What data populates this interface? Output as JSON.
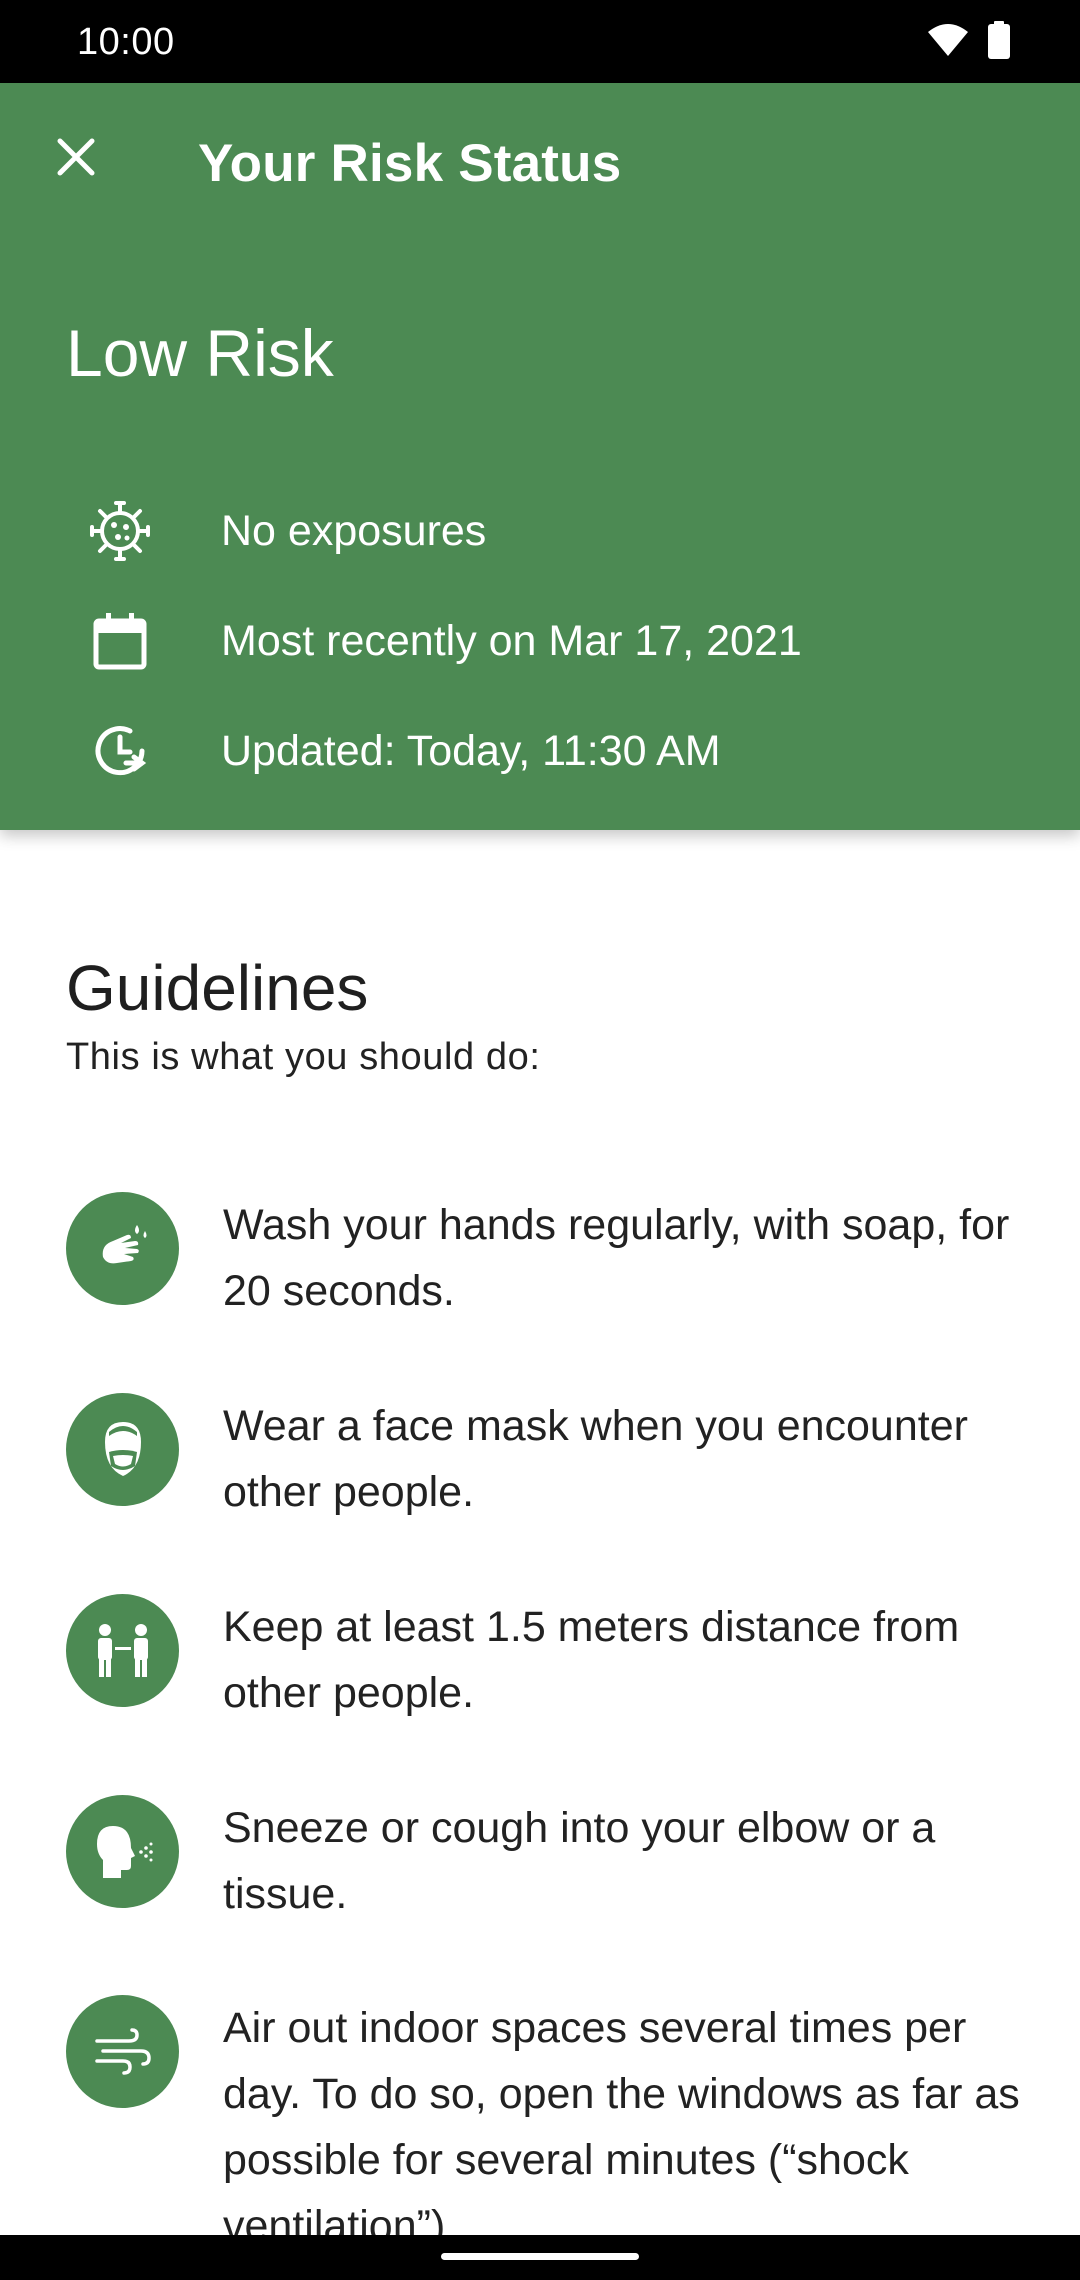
{
  "status_bar": {
    "time": "10:00",
    "icons": [
      "wifi-icon",
      "battery-icon"
    ]
  },
  "header": {
    "close_icon": "close-icon",
    "title": "Your Risk Status",
    "risk_level": "Low Risk",
    "rows": [
      {
        "icon": "virus-icon",
        "text": "No exposures"
      },
      {
        "icon": "calendar-icon",
        "text": "Most recently on Mar 17, 2021"
      },
      {
        "icon": "clock-refresh-icon",
        "text": "Updated: Today, 11:30 AM"
      }
    ]
  },
  "guidelines": {
    "title": "Guidelines",
    "subtitle": "This is what you should do:",
    "items": [
      {
        "icon": "hand-wash-icon",
        "text": "Wash your hands regularly, with soap, for 20 seconds."
      },
      {
        "icon": "face-mask-icon",
        "text": "Wear a face mask when you encounter other people."
      },
      {
        "icon": "distance-icon",
        "text": "Keep at least 1.5 meters distance from other people."
      },
      {
        "icon": "sneeze-icon",
        "text": "Sneeze or cough into your elbow or a tissue."
      },
      {
        "icon": "ventilation-icon",
        "text": "Air out indoor spaces several times per day. To do so, open the windows as far as possible for several minutes (“shock ventilation”)."
      }
    ]
  },
  "colors": {
    "accent": "#4c8a53",
    "text": "#222222",
    "status_bar": "#000000"
  }
}
